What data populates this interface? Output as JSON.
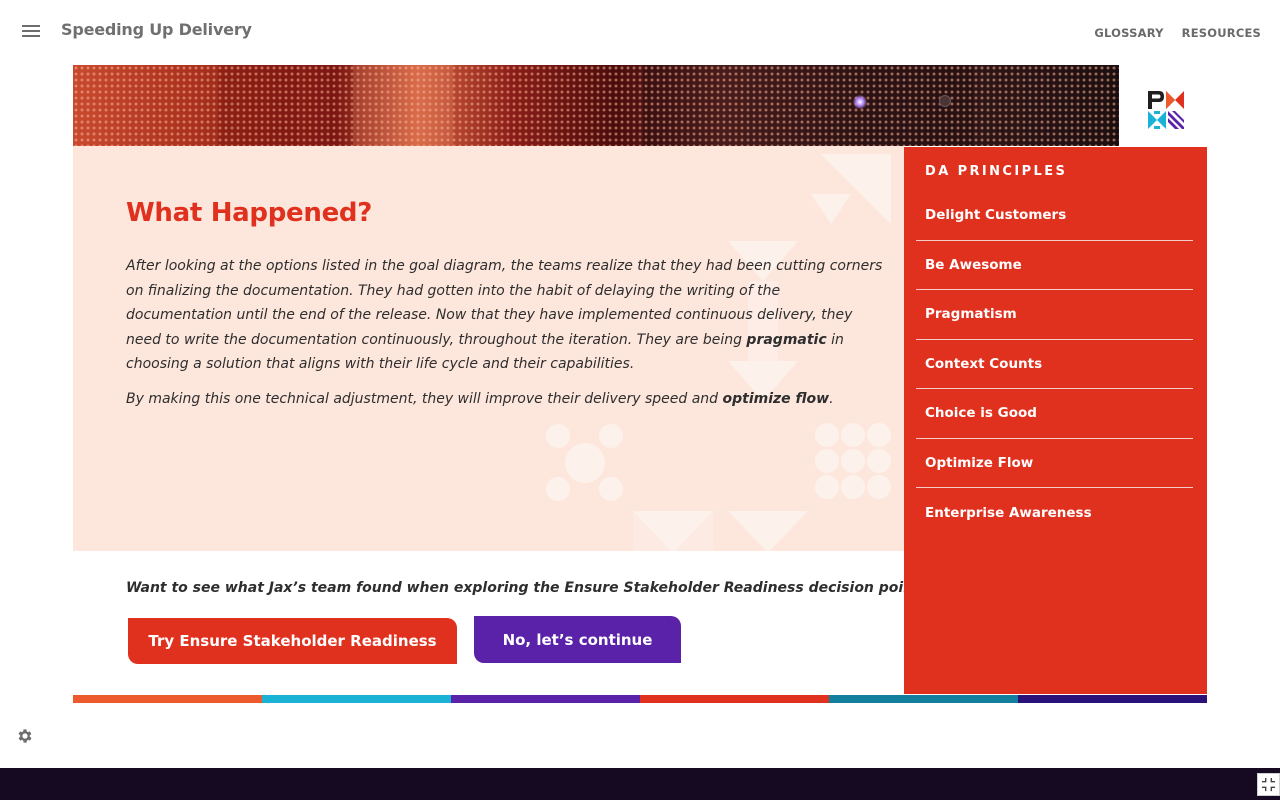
{
  "header": {
    "title": "Speeding Up Delivery",
    "links": [
      "GLOSSARY",
      "RESOURCES"
    ]
  },
  "main": {
    "title": "What Happened?",
    "paragraph1": {
      "before": "After looking at the options listed in the goal diagram, the teams realize that they had been cutting corners on finalizing the documentation. They had gotten into the habit of delaying the writing of the documentation until the end of the release. Now that they have implemented continuous delivery, they need to write the documentation continuously, throughout the iteration. They are being ",
      "bold": "pragmatic",
      "after": " in choosing a solution that aligns with their life cycle and their capabilities."
    },
    "paragraph2": {
      "before": "By making this one technical adjustment, they will improve their delivery speed and ",
      "bold": "optimize flow",
      "after": "."
    }
  },
  "prompt": "Want to see what Jax’s team found when exploring the Ensure Stakeholder Readiness decision point?",
  "buttons": {
    "try": "Try Ensure Stakeholder Readiness",
    "continue": "No, let’s continue"
  },
  "sidebar": {
    "heading": "DA PRINCIPLES",
    "items": [
      "Delight Customers",
      "Be Awesome",
      "Pragmatism",
      "Context Counts",
      "Choice is Good",
      "Optimize Flow",
      "Enterprise Awareness"
    ]
  },
  "colors": {
    "accent_red": "#e0301e",
    "accent_purple": "#5a22a8",
    "content_bg": "#fde6dc",
    "strip": [
      "#ec5a2e",
      "#1ab3d6",
      "#5a22a8",
      "#e0301e",
      "#137f9e",
      "#2b127a"
    ]
  },
  "icons": [
    "menu-icon",
    "pmi-logo",
    "settings-icon",
    "exit-fullscreen-icon"
  ]
}
